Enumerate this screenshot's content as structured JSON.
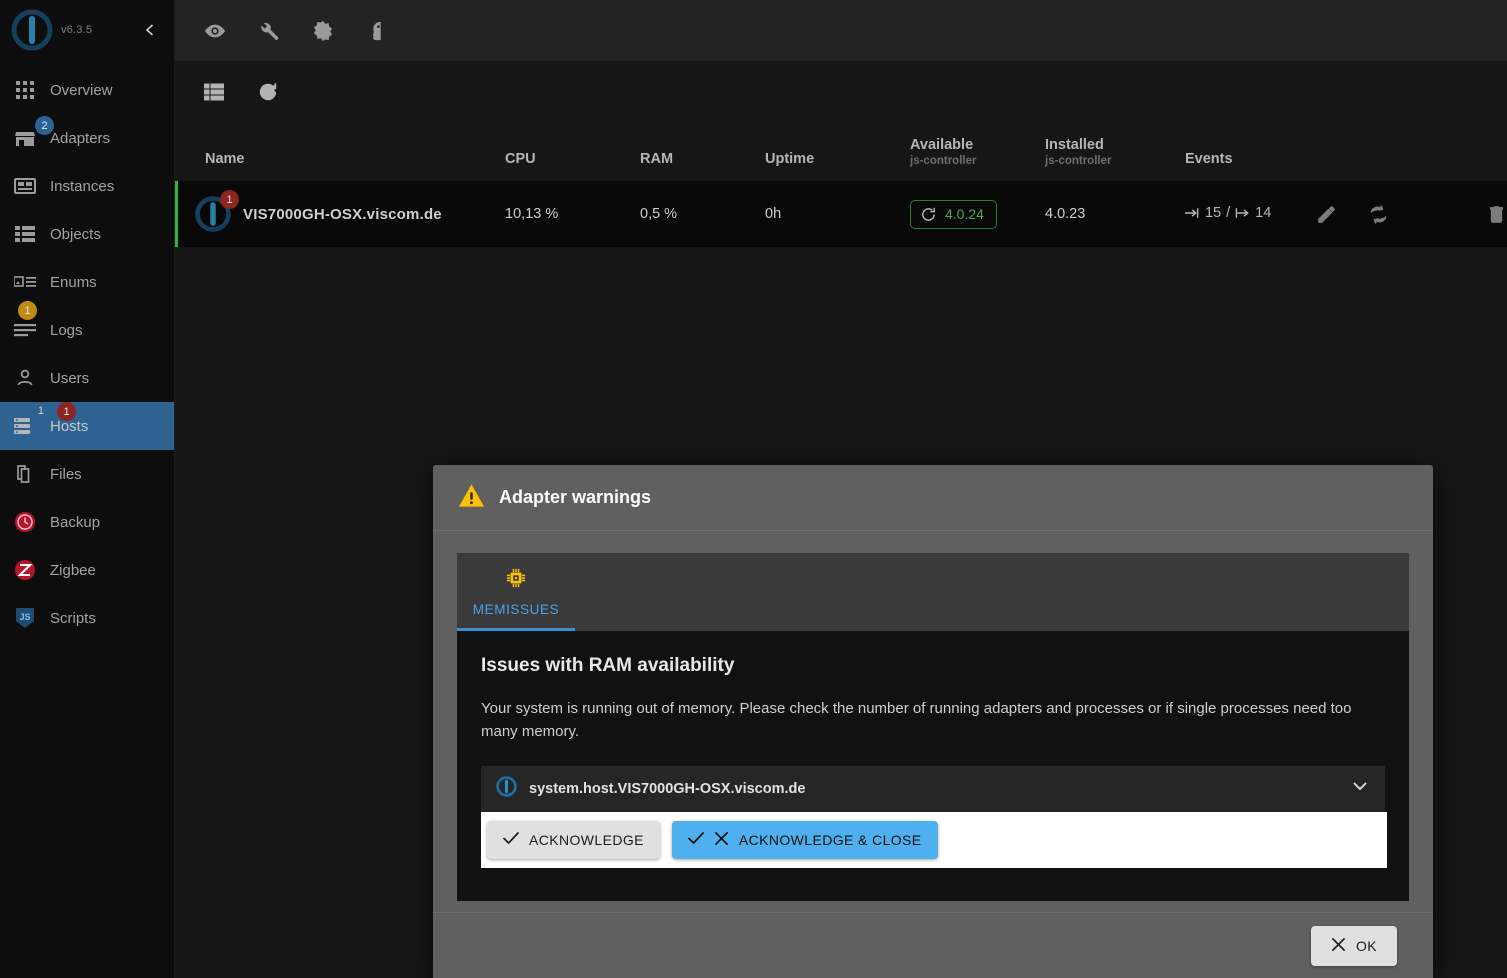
{
  "sidebar": {
    "version": "v6.3.5",
    "logo_icon": "iobroker-logo-icon",
    "collapse_icon": "chevron-left-icon",
    "items": [
      {
        "label": "Overview",
        "icon": "grid-icon",
        "badge": null,
        "sup": null,
        "selected": false
      },
      {
        "label": "Adapters",
        "icon": "store-icon",
        "badge": "2",
        "badge_color": "blue",
        "sup": null,
        "selected": false
      },
      {
        "label": "Instances",
        "icon": "instances-icon",
        "badge": null,
        "sup": null,
        "selected": false
      },
      {
        "label": "Objects",
        "icon": "list-icon",
        "badge": null,
        "sup": null,
        "selected": false
      },
      {
        "label": "Enums",
        "icon": "enums-icon",
        "badge": null,
        "sup": null,
        "selected": false
      },
      {
        "label": "Logs",
        "icon": "logs-icon",
        "badge": "1",
        "badge_color": "amber",
        "sup": null,
        "selected": false
      },
      {
        "label": "Users",
        "icon": "user-icon",
        "badge": null,
        "sup": null,
        "selected": false
      },
      {
        "label": "Hosts",
        "icon": "hosts-icon",
        "badge": "1",
        "badge_color": "red",
        "sup": "1",
        "selected": true
      },
      {
        "label": "Files",
        "icon": "files-icon",
        "badge": null,
        "sup": null,
        "selected": false
      },
      {
        "label": "Backup",
        "icon": "backup-icon",
        "badge": null,
        "sup": null,
        "selected": false
      },
      {
        "label": "Zigbee",
        "icon": "zigbee-icon",
        "badge": null,
        "sup": null,
        "selected": false
      },
      {
        "label": "Scripts",
        "icon": "scripts-js-icon",
        "badge": null,
        "sup": null,
        "selected": false
      }
    ]
  },
  "topbar": {
    "icons": [
      "eye-icon",
      "wrench-icon",
      "brightness-icon",
      "expert-mode-head-icon"
    ]
  },
  "toolbar": {
    "icons": [
      "list-view-icon",
      "refresh-icon"
    ]
  },
  "table": {
    "columns": [
      {
        "label": "Name",
        "sub": ""
      },
      {
        "label": "CPU",
        "sub": ""
      },
      {
        "label": "RAM",
        "sub": ""
      },
      {
        "label": "Uptime",
        "sub": ""
      },
      {
        "label": "Available",
        "sub": "js-controller"
      },
      {
        "label": "Installed",
        "sub": "js-controller"
      },
      {
        "label": "Events",
        "sub": ""
      }
    ],
    "rows": [
      {
        "name": "VIS7000GH-OSX.viscom.de",
        "host_badge": "1",
        "cpu": "10,13 %",
        "ram": "0,5 %",
        "uptime": "0h",
        "available": "4.0.24",
        "installed": "4.0.23",
        "events_in": "15",
        "events_out": "14",
        "status_color": "#2fb344",
        "available_color": "#4da74f",
        "actions": [
          "edit-icon",
          "restart-icon",
          "delete-icon"
        ]
      }
    ]
  },
  "dialog": {
    "title": "Adapter warnings",
    "title_icon": "warning-triangle-icon",
    "tabs": [
      {
        "label": "MEMISSUES",
        "icon": "memory-chip-icon",
        "active": true
      }
    ],
    "panel": {
      "heading": "Issues with RAM availability",
      "text": "Your system is running out of memory. Please check the number of running adapters and processes or if single processes need too many memory.",
      "item": {
        "icon": "iobroker-small-icon",
        "label": "system.host.VIS7000GH-OSX.viscom.de",
        "expand_icon": "chevron-down-icon"
      },
      "buttons": [
        {
          "label": "ACKNOWLEDGE",
          "icons": [
            "check-icon"
          ],
          "style": "plain"
        },
        {
          "label": "ACKNOWLEDGE & CLOSE",
          "icons": [
            "check-icon",
            "close-icon"
          ],
          "style": "primary"
        }
      ]
    },
    "footer": {
      "ok_label": "OK",
      "ok_icon": "close-icon"
    }
  },
  "colors": {
    "accent_blue": "#3b8fd4",
    "selected_nav": "#2d6291",
    "warning_yellow": "#FFC107",
    "status_green": "#2fb344",
    "primary_button": "#4fb0f0"
  }
}
